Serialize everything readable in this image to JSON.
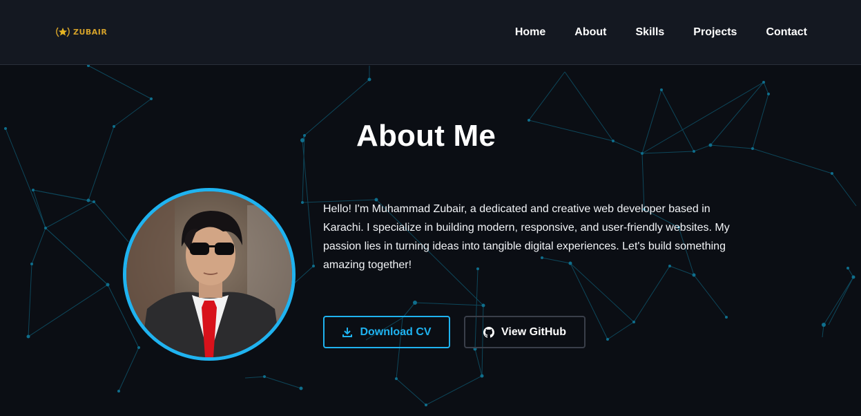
{
  "brand": {
    "name": "ZUBAIR",
    "color": "#d4a12a"
  },
  "nav": {
    "items": [
      {
        "label": "Home"
      },
      {
        "label": "About"
      },
      {
        "label": "Skills"
      },
      {
        "label": "Projects"
      },
      {
        "label": "Contact"
      }
    ]
  },
  "about": {
    "title": "About Me",
    "bio": "Hello! I'm Muhammad Zubair, a dedicated and creative web developer based in Karachi. I specialize in building modern, responsive, and user-friendly websites. My passion lies in turning ideas into tangible digital experiences. Let's build something amazing together!",
    "buttons": {
      "download_cv": {
        "label": "Download CV",
        "icon": "download-icon"
      },
      "view_github": {
        "label": "View GitHub",
        "icon": "github-icon"
      }
    }
  },
  "colors": {
    "accent": "#1fb3f0",
    "background": "#0b0e14",
    "header": "#141821",
    "network": "#0e5a72"
  }
}
